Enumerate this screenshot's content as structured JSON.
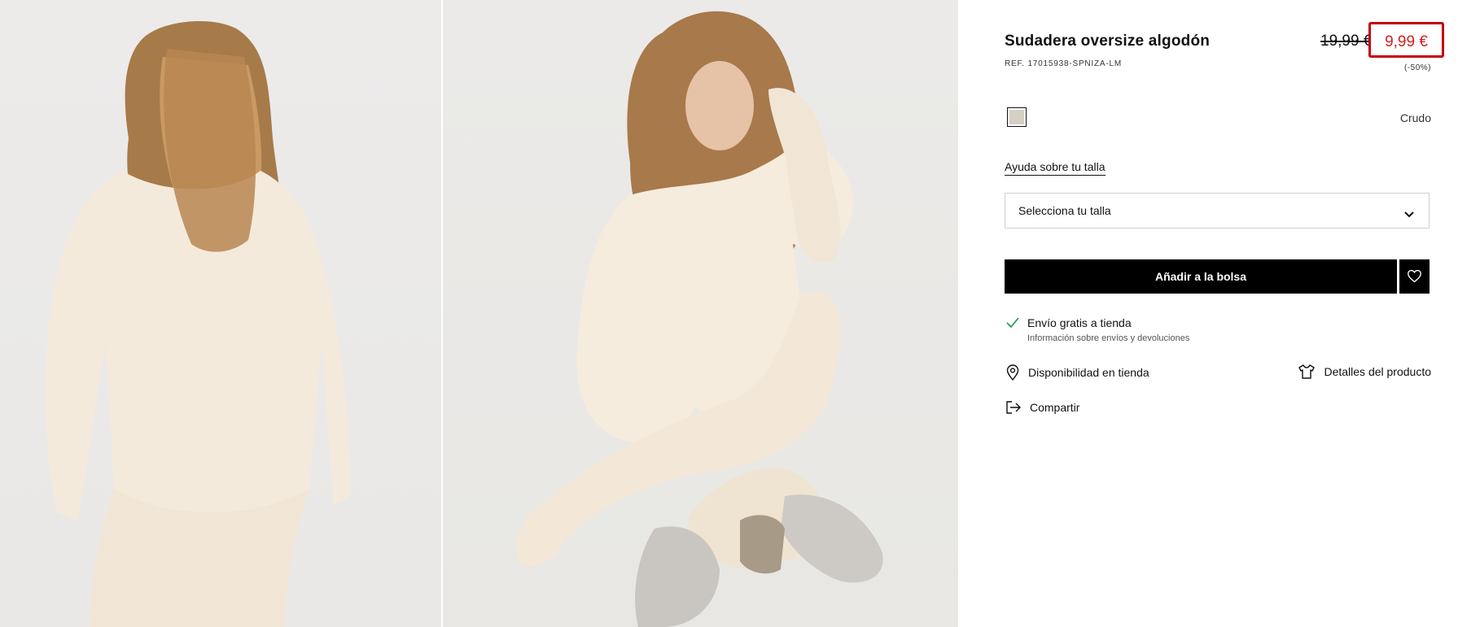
{
  "product": {
    "title": "Sudadera oversize algodón",
    "ref": "REF. 17015938-SPNIZA-LM",
    "old_price": "19,99 €",
    "new_price": "9,99 €",
    "discount": "(-50%)",
    "color_name": "Crudo",
    "swatch_color": "#d6cfc3",
    "price_highlight_color": "#c4000b",
    "sale_price_color": "#d31f1f"
  },
  "size": {
    "help_link": "Ayuda sobre tu talla",
    "select_placeholder": "Selecciona tu talla"
  },
  "actions": {
    "add_to_bag": "Añadir a la bolsa",
    "favorite_icon": "heart-icon"
  },
  "shipping": {
    "title": "Envío gratis a tienda",
    "info": "Información sobre envíos y devoluciones"
  },
  "links": {
    "store_availability": "Disponibilidad en tienda",
    "product_details": "Detalles del producto",
    "share": "Compartir"
  },
  "gallery": {
    "images": [
      "back-view-photo",
      "front-view-photo"
    ]
  }
}
